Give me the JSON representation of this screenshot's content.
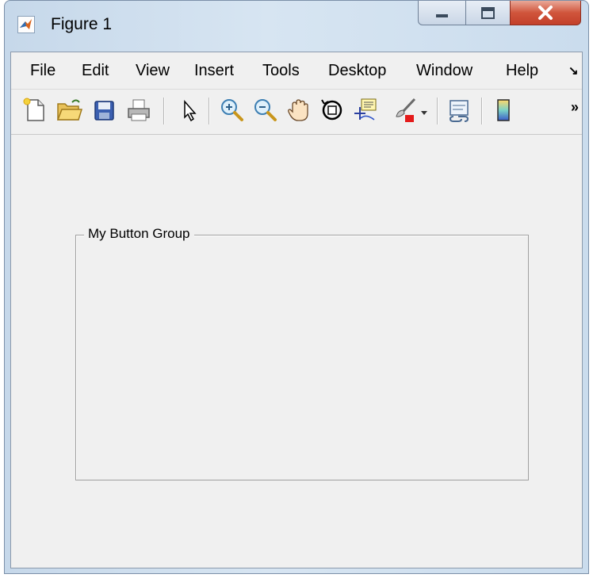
{
  "window": {
    "title": "Figure 1",
    "app_icon": "matlab-icon",
    "controls": [
      "minimize-icon",
      "maximize-icon",
      "close-icon"
    ]
  },
  "menubar": {
    "items": [
      {
        "label": "File"
      },
      {
        "label": "Edit"
      },
      {
        "label": "View"
      },
      {
        "label": "Insert"
      },
      {
        "label": "Tools"
      },
      {
        "label": "Desktop"
      },
      {
        "label": "Window"
      },
      {
        "label": "Help"
      }
    ],
    "overflow_icon": "overflow-arrow-icon"
  },
  "toolbar": {
    "buttons": [
      "new-figure-icon",
      "open-file-icon",
      "save-icon",
      "print-icon",
      "select-pointer-icon",
      "zoom-in-icon",
      "zoom-out-icon",
      "pan-hand-icon",
      "rotate-3d-icon",
      "data-cursor-icon",
      "brush-icon",
      "brush-dropdown-icon",
      "link-plot-icon",
      "colorbar-icon"
    ],
    "overflow_label": "»"
  },
  "canvas": {
    "button_group": {
      "title": "My Button Group"
    }
  },
  "colors": {
    "titlebar": "#d0e0f0",
    "close_button": "#c94a33",
    "client_background": "#f0f0f0",
    "panel_border": "#a0a0a0"
  }
}
